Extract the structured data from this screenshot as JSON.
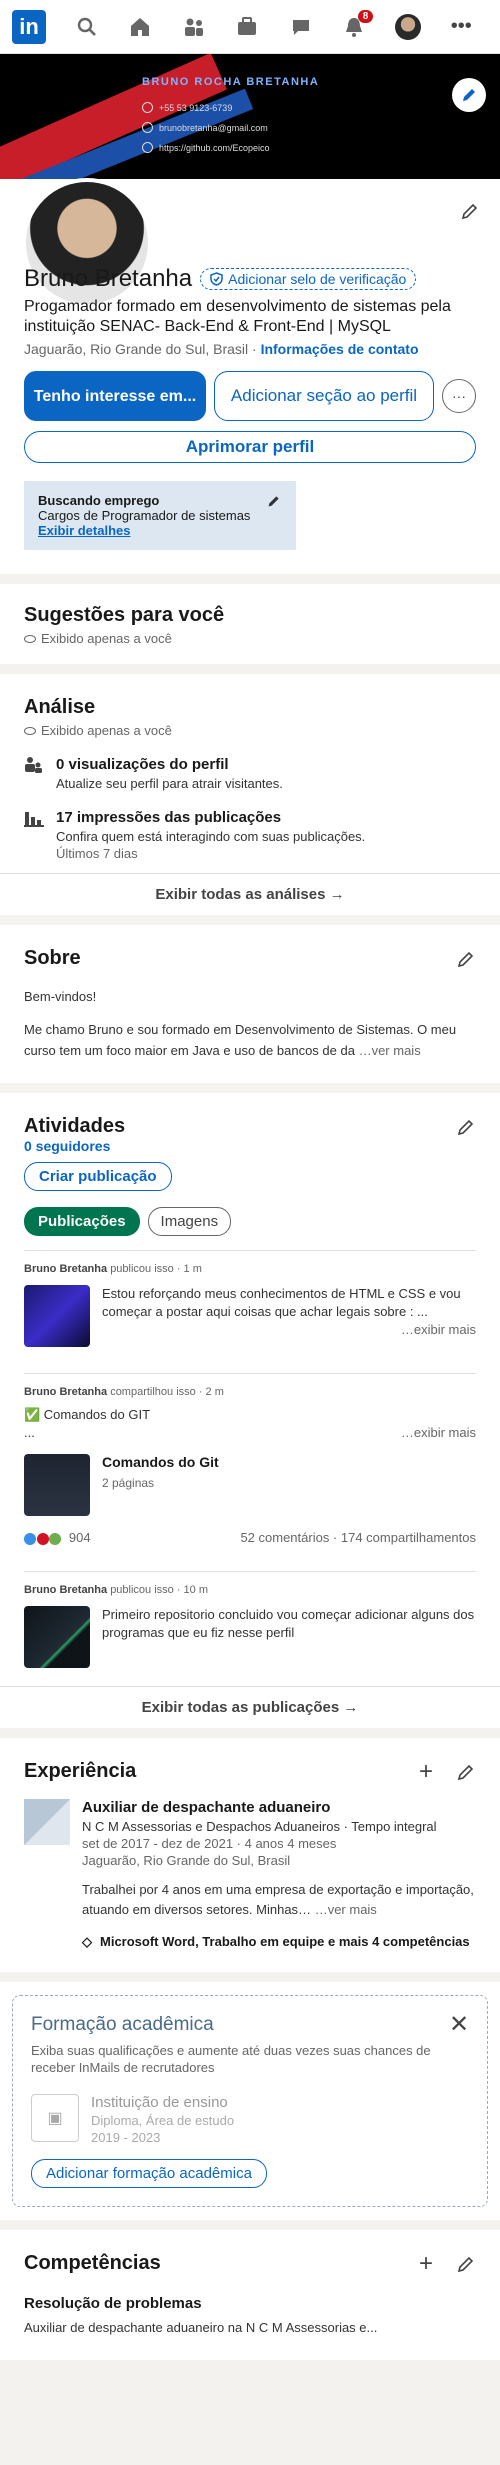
{
  "nav": {
    "notifications_badge": "8"
  },
  "banner": {
    "name": "BRUNO ROCHA BRETANHA",
    "phone": "+55 53 9123-6739",
    "email": "brunobretanha@gmail.com",
    "github": "https://github.com/Ecopeico"
  },
  "profile": {
    "name": "Bruno Bretanha",
    "verify_label": "Adicionar selo de verificação",
    "headline": "Progamador formado em desenvolvimento de sistemas pela instituição SENAC- Back-End & Front-End | MySQL",
    "location": "Jaguarão, Rio Grande do Sul, Brasil ·",
    "contact_link": "Informações de contato",
    "btn_interest": "Tenho interesse em...",
    "btn_add_section": "Adicionar seção ao perfil",
    "btn_more": "···",
    "btn_improve": "Aprimorar perfil",
    "open_to_work": {
      "title": "Buscando emprego",
      "role": "Cargos de Programador de sistemas",
      "link": "Exibir detalhes"
    }
  },
  "suggestions": {
    "title": "Sugestões para você",
    "private": "Exibido apenas a você"
  },
  "analytics": {
    "title": "Análise",
    "private": "Exibido apenas a você",
    "items": [
      {
        "title": "0 visualizações do perfil",
        "sub": "Atualize seu perfil para atrair visitantes.",
        "extra": ""
      },
      {
        "title": "17 impressões das publicações",
        "sub": "Confira quem está interagindo com suas publicações.",
        "extra": "Últimos 7 dias"
      }
    ],
    "footer": "Exibir todas as análises →"
  },
  "about": {
    "title": "Sobre",
    "greeting": "Bem-vindos!",
    "text": "Me chamo Bruno e sou formado em Desenvolvimento de Sistemas. O meu curso tem um foco maior em Java e uso de bancos de da",
    "more": "…ver mais"
  },
  "activity": {
    "title": "Atividades",
    "followers": "0 seguidores",
    "create_post": "Criar publicação",
    "tab_posts": "Publicações",
    "tab_images": "Imagens",
    "posts": [
      {
        "author": "Bruno Bretanha",
        "action": "publicou isso · 1 m",
        "text": "Estou reforçando meus conhecimentos de HTML e CSS e vou começar a postar aqui coisas que achar legais sobre : ...",
        "more": "…exibir mais"
      },
      {
        "author": "Bruno Bretanha",
        "action": "compartilhou isso · 2 m",
        "text": "✅ Comandos do GIT",
        "ellipsis": "...",
        "more": "…exibir mais",
        "doc_title": "Comandos do Git",
        "doc_pages": "2 páginas",
        "reactions_count": "904",
        "comments": "52 comentários · 174 compartilhamentos"
      },
      {
        "author": "Bruno Bretanha",
        "action": "publicou isso · 10 m",
        "text": "Primeiro repositorio concluido vou começar adicionar alguns dos programas que eu fiz nesse perfil"
      }
    ],
    "footer": "Exibir todas as publicações →"
  },
  "experience": {
    "title": "Experiência",
    "role": "Auxiliar de despachante aduaneiro",
    "company": "N C M Assessorias e Despachos Aduaneiros · Tempo integral",
    "dates": "set de 2017 - dez de 2021 · 4 anos 4 meses",
    "location": "Jaguarão, Rio Grande do Sul, Brasil",
    "description": "Trabalhei por 4 anos em uma empresa de exportação e importação, atuando em diversos setores. Minhas…",
    "more": "…ver mais",
    "skills": "Microsoft Word, Trabalho em equipe e mais 4 competências"
  },
  "education": {
    "title": "Formação acadêmica",
    "hint": "Exiba suas qualificações e aumente até duas vezes suas chances de receber InMails de recrutadores",
    "institution": "Instituição de ensino",
    "degree": "Diploma, Área de estudo",
    "years": "2019 - 2023",
    "add_button": "Adicionar formação acadêmica"
  },
  "skills": {
    "title": "Competências",
    "first_skill": "Resolução de problemas",
    "first_skill_sub": "Auxiliar de despachante aduaneiro na N C M Assessorias e..."
  }
}
